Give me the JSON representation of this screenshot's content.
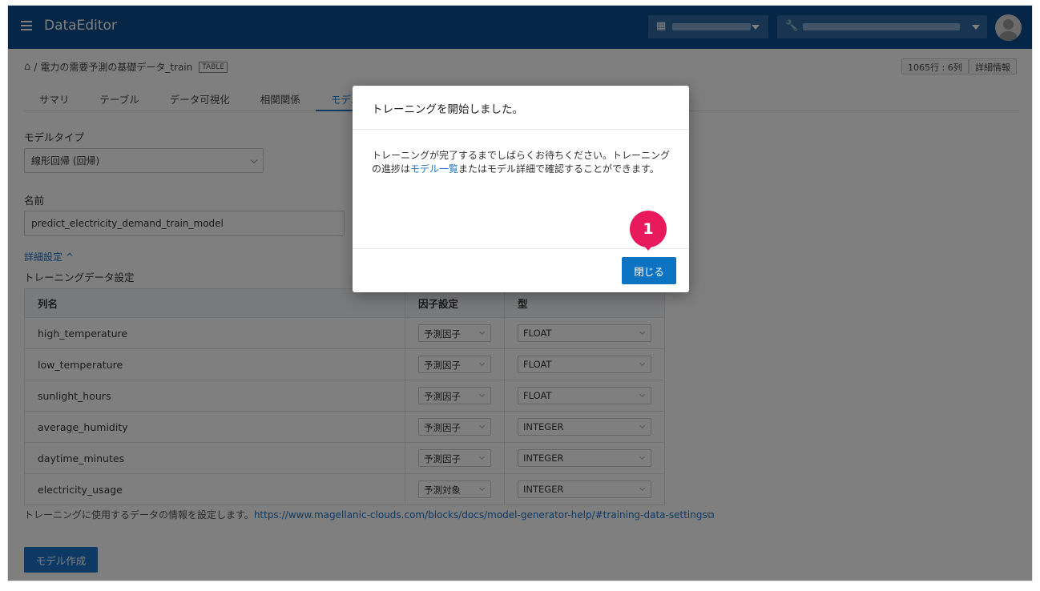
{
  "header": {
    "app_title": "DataEditor",
    "org_icon": "building-icon",
    "project_icon": "wrench-icon",
    "colors": {
      "bar": "#0b4d8c",
      "accent": "#1a73c9",
      "marker": "#e8195d"
    }
  },
  "breadcrumb": {
    "sep": "/",
    "dataset_name": "電力の需要予測の基礎データ_train",
    "type_tag": "TABLE"
  },
  "top_right": {
    "size_label": "1065行 : 6列",
    "detail_label": "詳細情報"
  },
  "tabs": [
    {
      "label": "サマリ"
    },
    {
      "label": "テーブル"
    },
    {
      "label": "データ可視化"
    },
    {
      "label": "相関関係"
    },
    {
      "label": "モデル作"
    }
  ],
  "form": {
    "model_type_label": "モデルタイプ",
    "model_type_value": "線形回帰 (回帰)",
    "name_label": "名前",
    "name_value": "predict_electricity_demand_train_model",
    "advanced_link": "詳細設定 ^",
    "training_label": "トレーニングデータ設定"
  },
  "table": {
    "headers": [
      "列名",
      "因子設定",
      "型"
    ],
    "rows": [
      {
        "name": "high_temperature",
        "factor": "予測因子",
        "type": "FLOAT"
      },
      {
        "name": "low_temperature",
        "factor": "予測因子",
        "type": "FLOAT"
      },
      {
        "name": "sunlight_hours",
        "factor": "予測因子",
        "type": "FLOAT"
      },
      {
        "name": "average_humidity",
        "factor": "予測因子",
        "type": "INTEGER"
      },
      {
        "name": "daytime_minutes",
        "factor": "予測因子",
        "type": "INTEGER"
      },
      {
        "name": "electricity_usage",
        "factor": "予測対象",
        "type": "INTEGER"
      }
    ]
  },
  "help": {
    "text": "トレーニングに使用するデータの情報を設定します。",
    "url": "https://www.magellanic-clouds.com/blocks/docs/model-generator-help/#training-data-settings"
  },
  "create_button": "モデル作成",
  "modal": {
    "title": "トレーニングを開始しました。",
    "body_pre": "トレーニングが完了するまでしばらくお待ちください。トレーニングの進捗は",
    "body_link": "モデル一覧",
    "body_post": "またはモデル詳細で確認することができます。",
    "close_label": "閉じる",
    "marker_number": "1"
  }
}
